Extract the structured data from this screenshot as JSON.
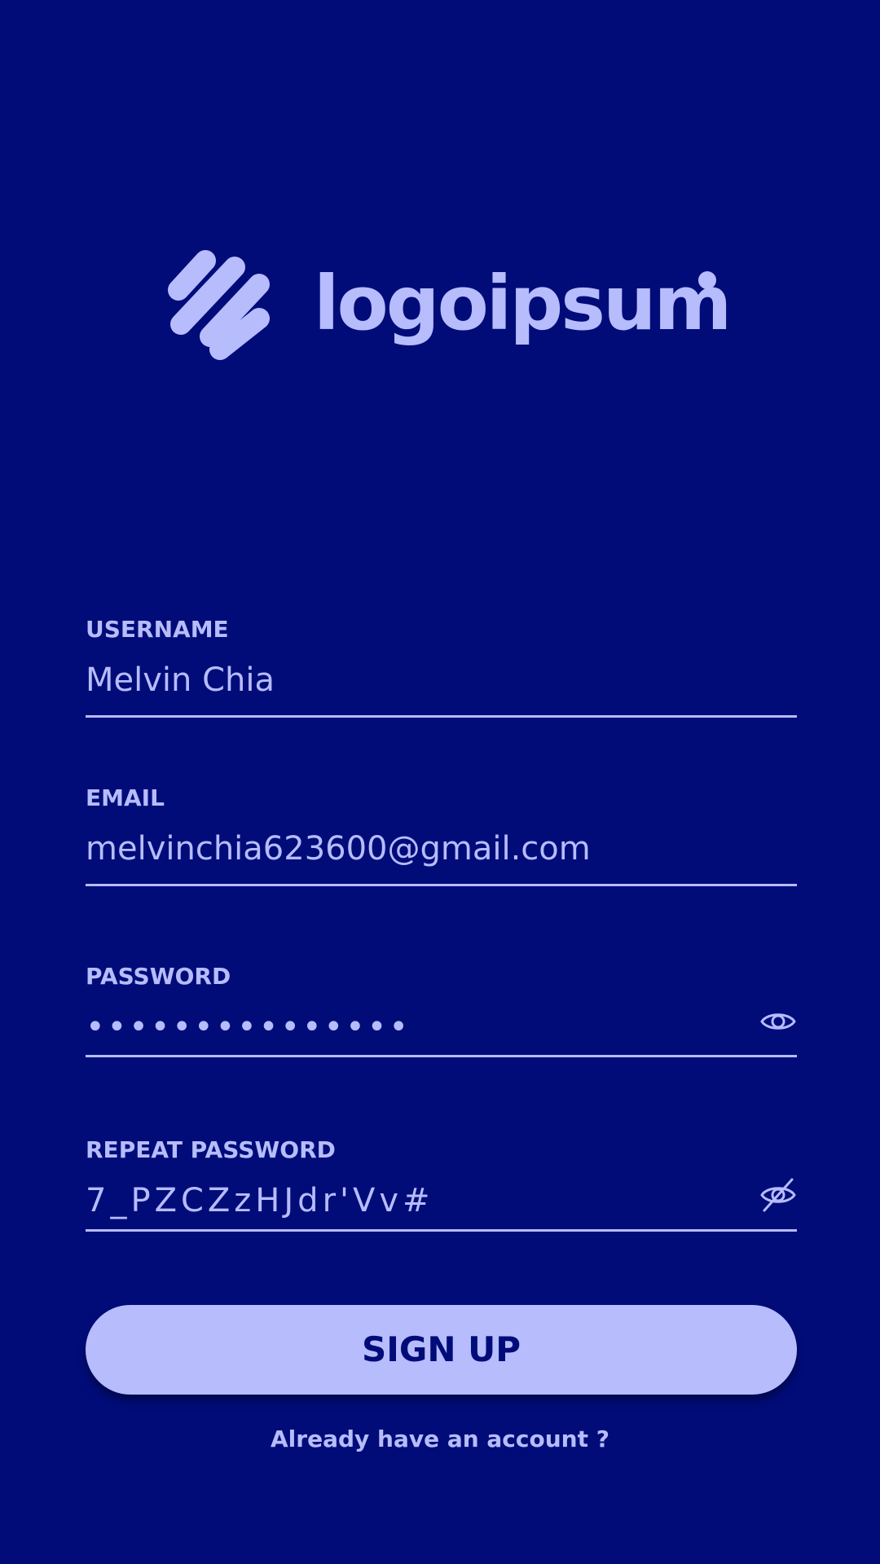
{
  "brand": {
    "name": "logoipsum",
    "color": "#b6bcfc",
    "background": "#010c79"
  },
  "form": {
    "username": {
      "label": "USERNAME",
      "value": "Melvin Chia"
    },
    "email": {
      "label": "EMAIL",
      "value": "melvinchia623600@gmail.com"
    },
    "password": {
      "label": "PASSWORD",
      "value": "•••••••••••••••",
      "toggle_icon": "eye-icon"
    },
    "repeat_password": {
      "label": "REPEAT PASSWORD",
      "value": "7_PZCZzHJdr'Vv#",
      "toggle_icon": "eye-off-icon"
    }
  },
  "actions": {
    "signup_label": "SIGN UP",
    "login_link": "Already have an account ?"
  }
}
